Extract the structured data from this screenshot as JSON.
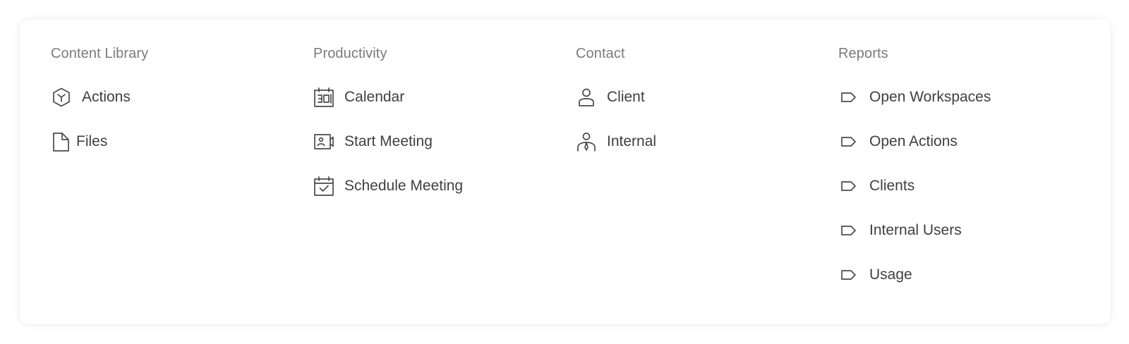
{
  "menu": {
    "columns": [
      {
        "title": "Content Library",
        "items": [
          {
            "label": "Actions",
            "icon": "cube-icon"
          },
          {
            "label": "Files",
            "icon": "file-icon"
          }
        ]
      },
      {
        "title": "Productivity",
        "items": [
          {
            "label": "Calendar",
            "icon": "calendar-30-icon"
          },
          {
            "label": "Start Meeting",
            "icon": "video-camera-icon"
          },
          {
            "label": "Schedule Meeting",
            "icon": "calendar-check-icon"
          }
        ]
      },
      {
        "title": "Contact",
        "items": [
          {
            "label": "Client",
            "icon": "user-icon"
          },
          {
            "label": "Internal",
            "icon": "user-tie-icon"
          }
        ]
      },
      {
        "title": "Reports",
        "items": [
          {
            "label": "Open Workspaces",
            "icon": "tag-icon"
          },
          {
            "label": "Open Actions",
            "icon": "tag-icon"
          },
          {
            "label": "Clients",
            "icon": "tag-icon"
          },
          {
            "label": "Internal Users",
            "icon": "tag-icon"
          },
          {
            "label": "Usage",
            "icon": "tag-icon"
          }
        ]
      }
    ]
  },
  "colors": {
    "heading": "#7a7a7a",
    "item_text": "#3f3f3f",
    "icon_stroke": "#4a4a4a",
    "background": "#ffffff"
  }
}
